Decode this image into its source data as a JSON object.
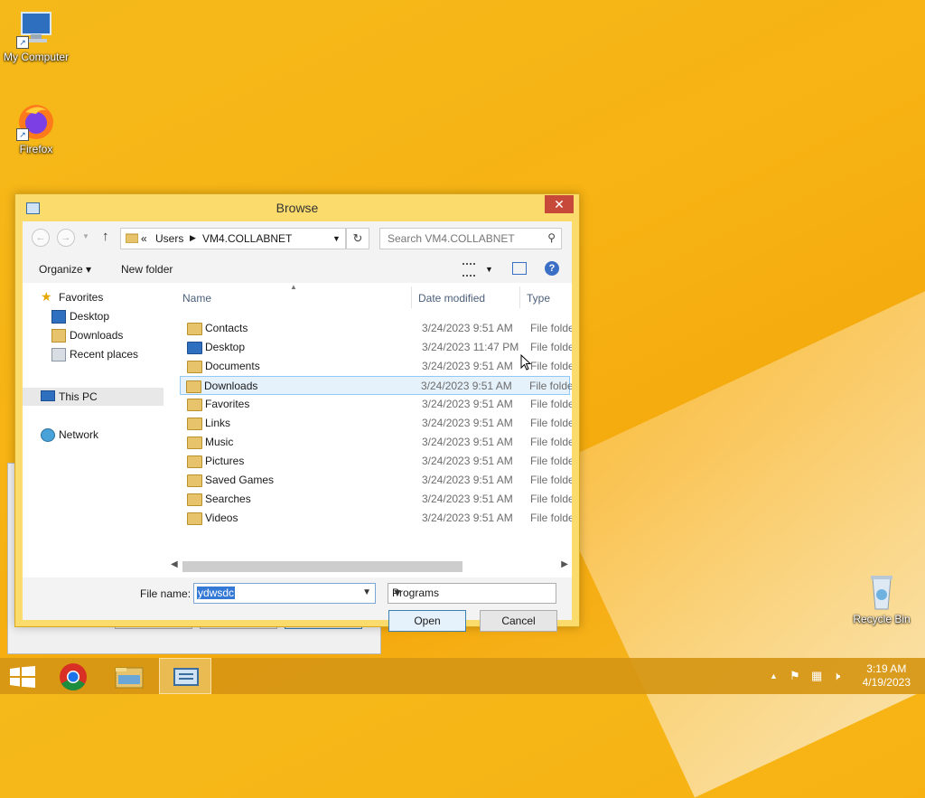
{
  "desktop": {
    "icons": [
      {
        "label": "My Computer"
      },
      {
        "label": "Firefox"
      },
      {
        "label": "Recycle Bin"
      }
    ]
  },
  "dialog": {
    "title": "Browse",
    "close_glyph": "✕",
    "address": {
      "overflow": "«",
      "crumbs": [
        "Users",
        "VM4.COLLABNET"
      ]
    },
    "search": {
      "placeholder": "Search VM4.COLLABNET"
    },
    "toolbar": {
      "organize": "Organize ▾",
      "new_folder": "New folder"
    },
    "nav": {
      "favorites": "Favorites",
      "desktop": "Desktop",
      "downloads": "Downloads",
      "recent": "Recent places",
      "this_pc": "This PC",
      "network": "Network"
    },
    "columns": {
      "name": "Name",
      "date": "Date modified",
      "type": "Type"
    },
    "rows": [
      {
        "name": "Contacts",
        "date": "3/24/2023 9:51 AM",
        "type": "File folder"
      },
      {
        "name": "Desktop",
        "date": "3/24/2023 11:47 PM",
        "type": "File folder"
      },
      {
        "name": "Documents",
        "date": "3/24/2023 9:51 AM",
        "type": "File folder"
      },
      {
        "name": "Downloads",
        "date": "3/24/2023 9:51 AM",
        "type": "File folder"
      },
      {
        "name": "Favorites",
        "date": "3/24/2023 9:51 AM",
        "type": "File folder"
      },
      {
        "name": "Links",
        "date": "3/24/2023 9:51 AM",
        "type": "File folder"
      },
      {
        "name": "Music",
        "date": "3/24/2023 9:51 AM",
        "type": "File folder"
      },
      {
        "name": "Pictures",
        "date": "3/24/2023 9:51 AM",
        "type": "File folder"
      },
      {
        "name": "Saved Games",
        "date": "3/24/2023 9:51 AM",
        "type": "File folder"
      },
      {
        "name": "Searches",
        "date": "3/24/2023 9:51 AM",
        "type": "File folder"
      },
      {
        "name": "Videos",
        "date": "3/24/2023 9:51 AM",
        "type": "File folder"
      }
    ],
    "selected_row": "Downloads",
    "file_name_label": "File name:",
    "file_name_value": "ydwsdc",
    "file_type": "Programs",
    "open_label": "Open",
    "cancel_label": "Cancel"
  },
  "taskbar": {
    "time": "3:19 AM",
    "date": "4/19/2023"
  },
  "colors": {
    "wallpaper": "#f7b313",
    "dialog_frame": "#fadb6c",
    "close_button": "#c7493a",
    "selection": "#e5f1fb"
  }
}
